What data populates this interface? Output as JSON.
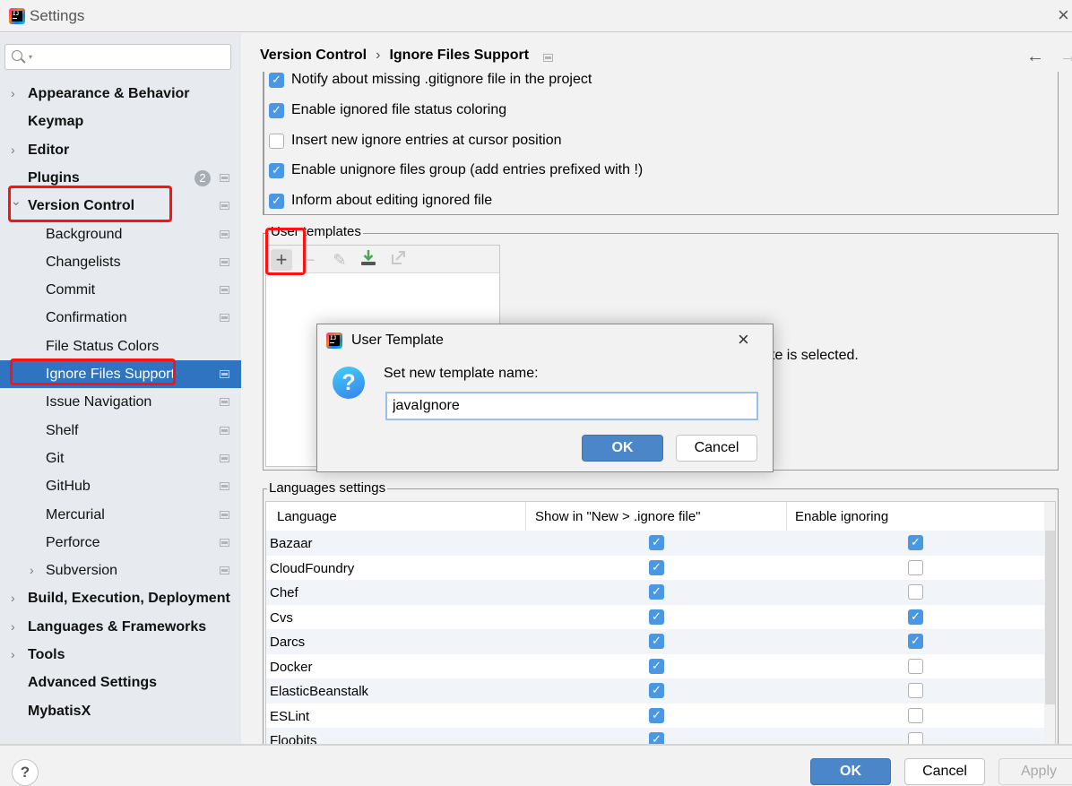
{
  "window": {
    "title": "Settings",
    "close_icon": "×"
  },
  "sidebar": {
    "search": {
      "value": "",
      "placeholder": ""
    },
    "items": [
      {
        "label": "Appearance & Behavior",
        "level": 0,
        "expandable": true,
        "expanded": false
      },
      {
        "label": "Keymap",
        "level": 0,
        "expandable": false
      },
      {
        "label": "Editor",
        "level": 0,
        "expandable": true,
        "expanded": false
      },
      {
        "label": "Plugins",
        "level": 0,
        "expandable": false,
        "badge": "2",
        "project_icon": true
      },
      {
        "label": "Version Control",
        "level": 0,
        "expandable": true,
        "expanded": true,
        "project_icon": true
      },
      {
        "label": "Background",
        "level": 1,
        "project_icon": true
      },
      {
        "label": "Changelists",
        "level": 1,
        "project_icon": true
      },
      {
        "label": "Commit",
        "level": 1,
        "project_icon": true
      },
      {
        "label": "Confirmation",
        "level": 1,
        "project_icon": true
      },
      {
        "label": "File Status Colors",
        "level": 1,
        "project_icon": false
      },
      {
        "label": "Ignore Files Support",
        "level": 1,
        "project_icon": true,
        "selected": true
      },
      {
        "label": "Issue Navigation",
        "level": 1,
        "project_icon": true
      },
      {
        "label": "Shelf",
        "level": 1,
        "project_icon": true
      },
      {
        "label": "Git",
        "level": 1,
        "project_icon": true
      },
      {
        "label": "GitHub",
        "level": 1,
        "project_icon": true
      },
      {
        "label": "Mercurial",
        "level": 1,
        "project_icon": true
      },
      {
        "label": "Perforce",
        "level": 1,
        "project_icon": true
      },
      {
        "label": "Subversion",
        "level": 1,
        "expandable": true,
        "expanded": false,
        "project_icon": true
      },
      {
        "label": "Build, Execution, Deployment",
        "level": 0,
        "expandable": true,
        "expanded": false
      },
      {
        "label": "Languages & Frameworks",
        "level": 0,
        "expandable": true,
        "expanded": false
      },
      {
        "label": "Tools",
        "level": 0,
        "expandable": true,
        "expanded": false
      },
      {
        "label": "Advanced Settings",
        "level": 0,
        "expandable": false
      },
      {
        "label": "MybatisX",
        "level": 0,
        "expandable": false
      }
    ]
  },
  "breadcrumb": {
    "parent": "Version Control",
    "separator": "›",
    "current": "Ignore Files Support",
    "back_icon": "←",
    "forward_icon": "→"
  },
  "options": [
    {
      "label": "Notify about missing .gitignore file in the project",
      "checked": true
    },
    {
      "label": "Enable ignored file status coloring",
      "checked": true
    },
    {
      "label": "Insert new ignore entries at cursor position",
      "checked": false
    },
    {
      "label": "Enable unignore files group (add entries prefixed with !)",
      "checked": true
    },
    {
      "label": "Inform about editing ignored file",
      "checked": true
    }
  ],
  "user_templates": {
    "legend": "User templates",
    "toolbar": {
      "add": "+",
      "remove": "−",
      "edit": "✎",
      "import": "⤓",
      "export": "⇱"
    },
    "hint_partial": "te is selected."
  },
  "languages": {
    "legend": "Languages settings",
    "columns": [
      "Language",
      "Show in \"New > .ignore file\"",
      "Enable ignoring"
    ],
    "rows": [
      {
        "name": "Bazaar",
        "show": true,
        "enable": true
      },
      {
        "name": "CloudFoundry",
        "show": true,
        "enable": false
      },
      {
        "name": "Chef",
        "show": true,
        "enable": false
      },
      {
        "name": "Cvs",
        "show": true,
        "enable": true
      },
      {
        "name": "Darcs",
        "show": true,
        "enable": true
      },
      {
        "name": "Docker",
        "show": true,
        "enable": false
      },
      {
        "name": "ElasticBeanstalk",
        "show": true,
        "enable": false
      },
      {
        "name": "ESLint",
        "show": true,
        "enable": false
      },
      {
        "name": "Floobits",
        "show": true,
        "enable": false
      }
    ]
  },
  "dialog": {
    "title": "User Template",
    "close_icon": "×",
    "prompt": "Set new template name:",
    "input_value": "javaIgnore",
    "ok_label": "OK",
    "cancel_label": "Cancel"
  },
  "footer": {
    "help_label": "?",
    "ok_label": "OK",
    "cancel_label": "Cancel",
    "apply_label": "Apply"
  },
  "colors": {
    "accent": "#2f74c0",
    "checkbox": "#4a97e4",
    "highlight_annotation": "#ff1111"
  }
}
